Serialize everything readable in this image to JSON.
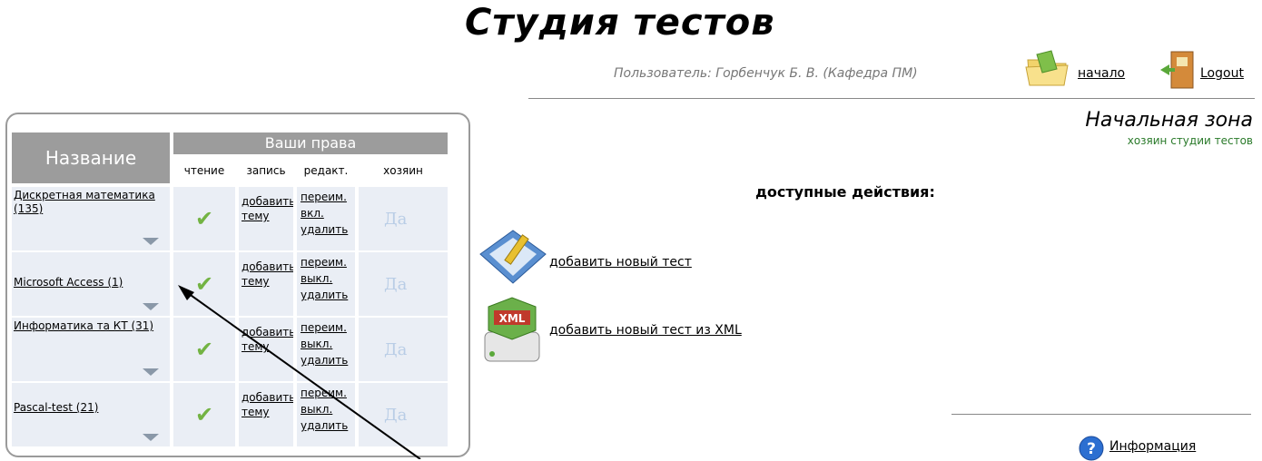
{
  "header": {
    "title": "Студия тестов",
    "user_line": "Пользователь: Горбенчук Б. В. (Кафедра ПМ)",
    "nav_start": "начало",
    "nav_logout": "Logout"
  },
  "zone": {
    "title": "Начальная зона",
    "subtitle": "хозяин студии тестов"
  },
  "actions": {
    "heading": "доступные действия:",
    "add_test": "добавить новый тест",
    "add_test_xml": "добавить новый тест из XML"
  },
  "footer": {
    "info_link": "Информация"
  },
  "table": {
    "col_name": "Название",
    "rights_header": "Ваши права",
    "sub_headers": [
      "чтение",
      "запись",
      "редакт.",
      "хозяин"
    ],
    "rows": [
      {
        "name": "Дискретная математика (135)",
        "write": "добавить тему",
        "edit": [
          "переим.",
          "вкл.",
          "удалить"
        ],
        "owner": "Да"
      },
      {
        "name": "Microsoft Access (1)",
        "write": "добавить тему",
        "edit": [
          "переим.",
          "выкл.",
          "удалить"
        ],
        "owner": "Да"
      },
      {
        "name": "Информатика та КТ (31)",
        "write": "добавить тему",
        "edit": [
          "переим.",
          "выкл.",
          "удалить"
        ],
        "owner": "Да"
      },
      {
        "name": "Pascal-test (21)",
        "write": "добавить тему",
        "edit": [
          "переим.",
          "выкл.",
          "удалить"
        ],
        "owner": "Да"
      }
    ]
  },
  "colors": {
    "header_gray": "#9c9c9c",
    "cell_bg": "#eaeef5",
    "check_green": "#73b343",
    "owner_blue": "#b9cde6"
  }
}
